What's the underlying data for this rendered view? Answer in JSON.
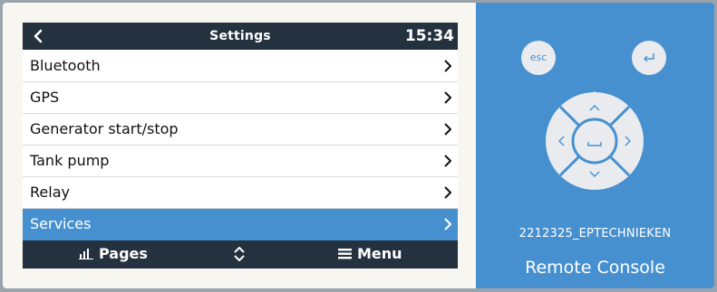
{
  "screen": {
    "title": "Settings",
    "clock": "15:34",
    "items": [
      {
        "label": "Bluetooth"
      },
      {
        "label": "GPS"
      },
      {
        "label": "Generator start/stop"
      },
      {
        "label": "Tank pump"
      },
      {
        "label": "Relay"
      },
      {
        "label": "Services",
        "selected": true
      }
    ],
    "bottom": {
      "pages_label": "Pages",
      "menu_label": "Menu"
    }
  },
  "remote": {
    "esc_label": "esc",
    "device_id": "2212325_EPTECHNIEKEN",
    "title": "Remote Console"
  },
  "colors": {
    "bar": "#24313f",
    "accent": "#4790d0",
    "panel": "#4790d0",
    "frame": "#f7f6f1"
  },
  "icons": {
    "back": "chevron-left-icon",
    "row_chevron": "chevron-right-icon",
    "pages": "bar-chart-icon",
    "updown": "up-down-arrows-icon",
    "menu": "hamburger-icon",
    "enter": "enter-return-icon",
    "dpad_center": "space-icon"
  }
}
